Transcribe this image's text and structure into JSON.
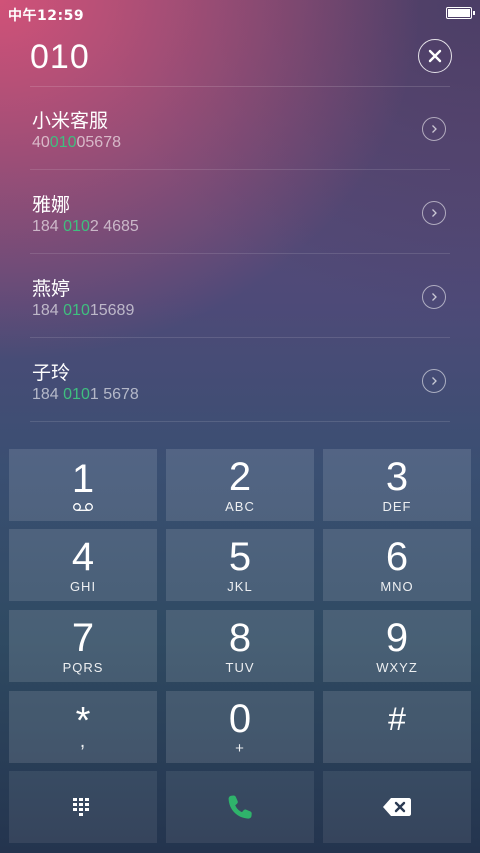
{
  "status_bar": {
    "time": "中午12:59",
    "battery_icon": "battery-full-icon"
  },
  "dialer": {
    "typed_number": "010",
    "clear_icon": "close-icon"
  },
  "results": [
    {
      "name": "小米客服",
      "number_prefix": "40",
      "number_match": "010",
      "number_suffix": "05678"
    },
    {
      "name": "雅娜",
      "number_prefix": "184 ",
      "number_match": "010",
      "number_suffix": "2 4685"
    },
    {
      "name": "燕婷",
      "number_prefix": "184 ",
      "number_match": "010",
      "number_suffix": "15689"
    },
    {
      "name": "子玲",
      "number_prefix": "184 ",
      "number_match": "010",
      "number_suffix": "1 5678"
    }
  ],
  "keypad": {
    "keys": [
      {
        "digit": "1",
        "letters": ""
      },
      {
        "digit": "2",
        "letters": "ABC"
      },
      {
        "digit": "3",
        "letters": "DEF"
      },
      {
        "digit": "4",
        "letters": "GHI"
      },
      {
        "digit": "5",
        "letters": "JKL"
      },
      {
        "digit": "6",
        "letters": "MNO"
      },
      {
        "digit": "7",
        "letters": "PQRS"
      },
      {
        "digit": "8",
        "letters": "TUV"
      },
      {
        "digit": "9",
        "letters": "WXYZ"
      },
      {
        "digit": "*",
        "letters": ","
      },
      {
        "digit": "0",
        "letters": "+"
      },
      {
        "digit": "#",
        "letters": ""
      }
    ],
    "bottom": {
      "left_icon": "dialpad-icon",
      "center_icon": "phone-call-icon",
      "right_icon": "backspace-icon"
    }
  },
  "colors": {
    "match_highlight": "#3fbf7f",
    "call_green": "#2fb36b"
  }
}
